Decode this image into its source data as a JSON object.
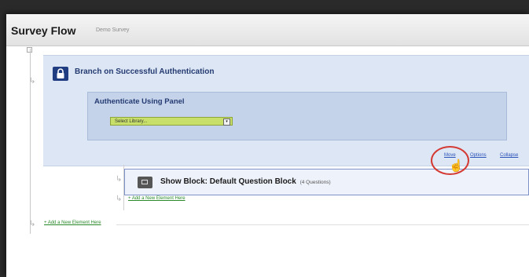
{
  "header": {
    "title": "Survey Flow",
    "subtitle": "Demo Survey"
  },
  "branch": {
    "title": "Branch on Successful Authentication",
    "panel_title": "Authenticate Using Panel",
    "library_select": {
      "value": "Select Library...",
      "arrow": "▾"
    },
    "actions": {
      "move": "Move",
      "options": "Options",
      "collapse": "Collapse"
    }
  },
  "block": {
    "title": "Show Block: Default Question Block",
    "count": "(4 Questions)"
  },
  "add_element_inner": "+ Add a New Element Here",
  "add_element_outer": "+ Add a New Element Here",
  "icons": {
    "arrow": "↳",
    "cursor": "☝"
  },
  "colors": {
    "branch_bg": "#dde6f4",
    "auth_bg": "#c4d2ea",
    "lock_badge": "#1f3d80",
    "select_bg": "#c8e06a",
    "link": "#2952b8",
    "add_link": "#2a8a2a",
    "highlight": "#d43a34"
  }
}
